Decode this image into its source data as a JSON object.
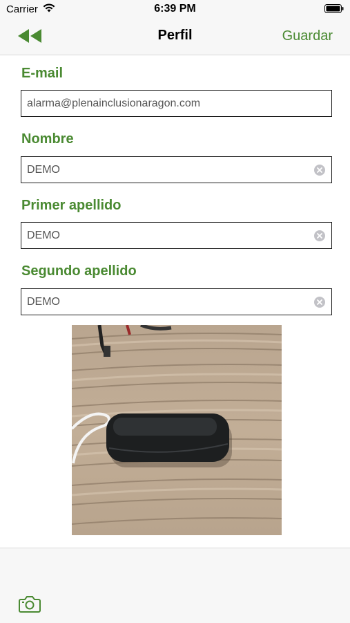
{
  "status_bar": {
    "carrier": "Carrier",
    "time": "6:39 PM",
    "icons": [
      "wifi-icon",
      "battery-icon"
    ]
  },
  "nav": {
    "title": "Perfil",
    "back_icon": "double-chevron-left-icon",
    "save_label": "Guardar"
  },
  "form": {
    "email": {
      "label": "E-mail",
      "value": "alarma@plenainclusionaragon.com"
    },
    "nombre": {
      "label": "Nombre",
      "value": "DEMO"
    },
    "primer_apellido": {
      "label": "Primer apellido",
      "value": "DEMO"
    },
    "segundo_apellido": {
      "label": "Segundo apellido",
      "value": "DEMO"
    }
  },
  "photo": {
    "icon": "profile-photo"
  },
  "toolbar": {
    "camera_icon": "camera-icon"
  },
  "colors": {
    "accent_green": "#4a8a32",
    "bar_background": "#f7f7f7",
    "field_border": "#1c1c1c",
    "clear_button": "#c2c2c7"
  }
}
